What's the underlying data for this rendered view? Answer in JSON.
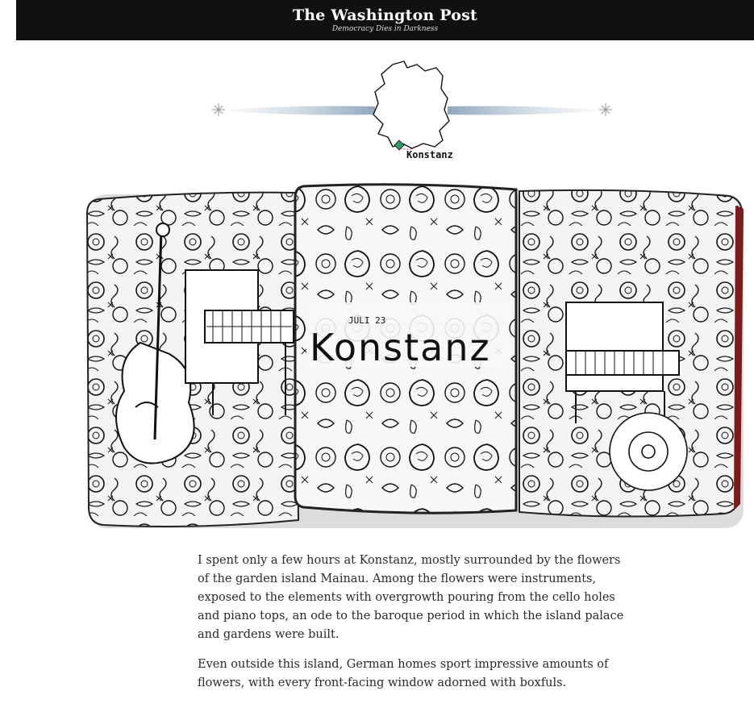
{
  "masthead": {
    "logo": "The Washington Post",
    "tagline": "Democracy Dies in Darkness"
  },
  "map": {
    "location_label": "Konstanz",
    "marker_color": "#2e9a6a"
  },
  "illustration": {
    "title": "Konstanz",
    "date": "JULI 23"
  },
  "article": {
    "paragraphs": [
      "I spent only a few hours at Konstanz, mostly surrounded by the flowers of the garden island Mainau. Among the flowers were instruments, exposed to the elements with overgrowth pouring from the cello holes and piano tops, an ode to the baroque period in which the island palace and gardens were built.",
      "Even outside this island, German homes sport impressive amounts of flowers, with every front-facing window adorned with boxfuls."
    ]
  }
}
